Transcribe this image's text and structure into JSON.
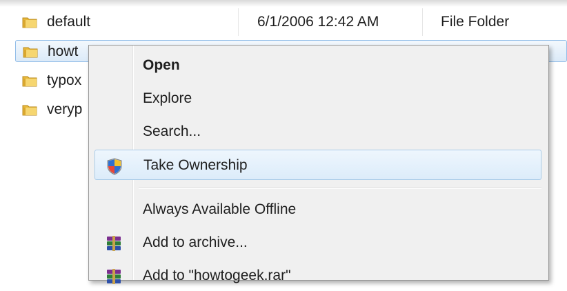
{
  "files": [
    {
      "name": "default",
      "date": "6/1/2006 12:42 AM",
      "type": "File Folder"
    },
    {
      "name": "howt",
      "date": "",
      "type": ""
    },
    {
      "name": "typox",
      "date": "",
      "type": ""
    },
    {
      "name": "veryp",
      "date": "",
      "type": ""
    }
  ],
  "context_menu": {
    "items": [
      {
        "label": "Open",
        "icon": "",
        "bold": true
      },
      {
        "label": "Explore",
        "icon": ""
      },
      {
        "label": "Search...",
        "icon": ""
      },
      {
        "label": "Take Ownership",
        "icon": "uac-shield-icon"
      },
      {
        "label": "Always Available Offline",
        "icon": ""
      },
      {
        "label": "Add to archive...",
        "icon": "winrar-icon"
      },
      {
        "label": "Add to \"howtogeek.rar\"",
        "icon": "winrar-icon"
      }
    ]
  },
  "colors": {
    "selection_border": "#92bde8",
    "menu_background": "#f0f0f0",
    "folder_yellow": "#f2c94c"
  }
}
